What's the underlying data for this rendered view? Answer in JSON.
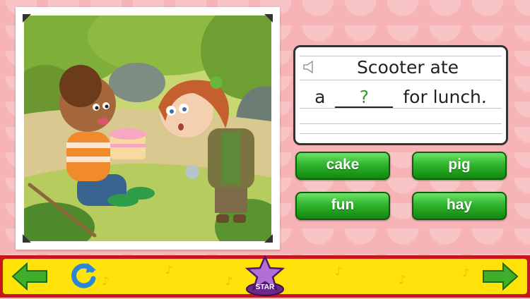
{
  "sentence": {
    "line1": "Scooter ate",
    "line2_prefix": "a",
    "blank": "?",
    "line2_suffix": "for lunch."
  },
  "answers": [
    "cake",
    "pig",
    "fun",
    "hay"
  ],
  "toolbar": {
    "star_label": "STAR"
  },
  "colors": {
    "background": "#f7b4b6",
    "toolbar_border": "#c6181c",
    "toolbar_fill": "#ffe20a",
    "answer_green": "#2fb52d",
    "blank_green": "#2e9e2e"
  },
  "icons": [
    "speaker-icon",
    "back-arrow-icon",
    "replay-icon",
    "star-icon",
    "next-arrow-icon",
    "music-note-icon"
  ]
}
